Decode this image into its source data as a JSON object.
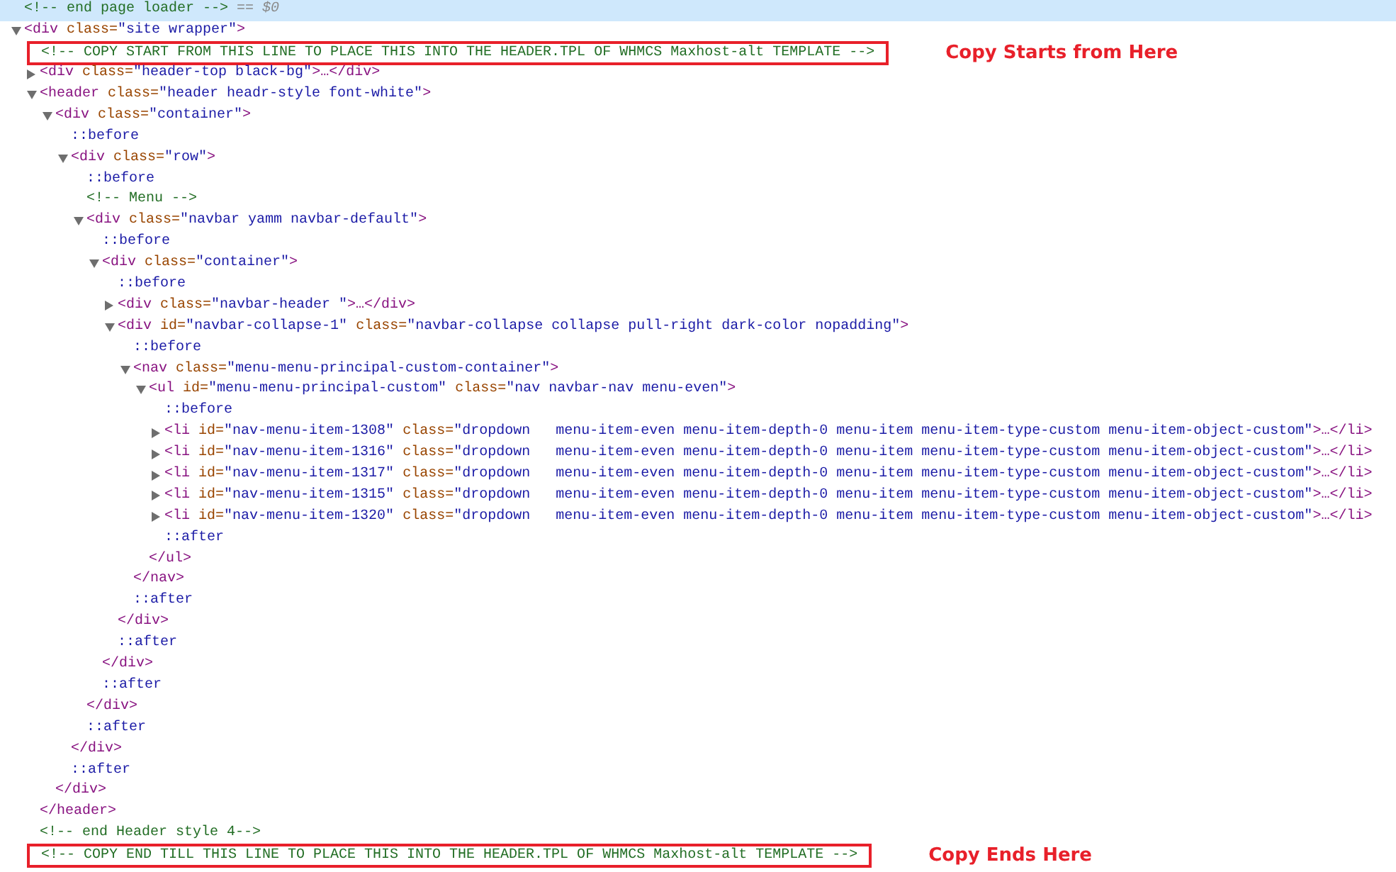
{
  "dom_tree": [
    {
      "kind": "comment",
      "selected": true,
      "open": [
        {
          "kind": "comment",
          "text": "<!-- end page loader -->"
        },
        {
          "kind": "hint",
          "text": " == $0"
        }
      ]
    },
    {
      "kind": "element",
      "selected": false,
      "expanded": true,
      "open": [
        {
          "kind": "tag",
          "text": "<div"
        },
        {
          "kind": "attr",
          "text": " class="
        },
        {
          "kind": "value",
          "text": "\"site wrapper\""
        },
        {
          "kind": "tag",
          "text": ">"
        }
      ],
      "children": [
        {
          "kind": "comment",
          "boxed": true,
          "annotation": "Copy Starts from Here",
          "open": [
            {
              "kind": "comment",
              "text": "<!-- COPY START FROM THIS LINE TO PLACE THIS INTO THE HEADER.TPL OF WHMCS Maxhost-alt TEMPLATE -->"
            }
          ]
        },
        {
          "kind": "element",
          "expanded": false,
          "open": [
            {
              "kind": "tag",
              "text": "<div"
            },
            {
              "kind": "attr",
              "text": " class="
            },
            {
              "kind": "value",
              "text": "\"header-top black-bg\""
            },
            {
              "kind": "tag",
              "text": ">…</div>"
            }
          ]
        },
        {
          "kind": "element",
          "expanded": true,
          "open": [
            {
              "kind": "tag",
              "text": "<header"
            },
            {
              "kind": "attr",
              "text": " class="
            },
            {
              "kind": "value",
              "text": "\"header headr-style font-white\""
            },
            {
              "kind": "tag",
              "text": ">"
            }
          ],
          "children": [
            {
              "kind": "element",
              "expanded": true,
              "open": [
                {
                  "kind": "tag",
                  "text": "<div"
                },
                {
                  "kind": "attr",
                  "text": " class="
                },
                {
                  "kind": "value",
                  "text": "\"container\""
                },
                {
                  "kind": "tag",
                  "text": ">"
                }
              ],
              "children": [
                {
                  "kind": "pseudo",
                  "open": [
                    {
                      "kind": "pseudo",
                      "text": "::before"
                    }
                  ]
                },
                {
                  "kind": "element",
                  "expanded": true,
                  "open": [
                    {
                      "kind": "tag",
                      "text": "<div"
                    },
                    {
                      "kind": "attr",
                      "text": " class="
                    },
                    {
                      "kind": "value",
                      "text": "\"row\""
                    },
                    {
                      "kind": "tag",
                      "text": ">"
                    }
                  ],
                  "children": [
                    {
                      "kind": "pseudo",
                      "open": [
                        {
                          "kind": "pseudo",
                          "text": "::before"
                        }
                      ]
                    },
                    {
                      "kind": "comment",
                      "open": [
                        {
                          "kind": "comment",
                          "text": "<!-- Menu -->"
                        }
                      ]
                    },
                    {
                      "kind": "element",
                      "expanded": true,
                      "open": [
                        {
                          "kind": "tag",
                          "text": "<div"
                        },
                        {
                          "kind": "attr",
                          "text": " class="
                        },
                        {
                          "kind": "value",
                          "text": "\"navbar yamm navbar-default\""
                        },
                        {
                          "kind": "tag",
                          "text": ">"
                        }
                      ],
                      "children": [
                        {
                          "kind": "pseudo",
                          "open": [
                            {
                              "kind": "pseudo",
                              "text": "::before"
                            }
                          ]
                        },
                        {
                          "kind": "element",
                          "expanded": true,
                          "open": [
                            {
                              "kind": "tag",
                              "text": "<div"
                            },
                            {
                              "kind": "attr",
                              "text": " class="
                            },
                            {
                              "kind": "value",
                              "text": "\"container\""
                            },
                            {
                              "kind": "tag",
                              "text": ">"
                            }
                          ],
                          "children": [
                            {
                              "kind": "pseudo",
                              "open": [
                                {
                                  "kind": "pseudo",
                                  "text": "::before"
                                }
                              ]
                            },
                            {
                              "kind": "element",
                              "expanded": false,
                              "open": [
                                {
                                  "kind": "tag",
                                  "text": "<div"
                                },
                                {
                                  "kind": "attr",
                                  "text": " class="
                                },
                                {
                                  "kind": "value",
                                  "text": "\"navbar-header \""
                                },
                                {
                                  "kind": "tag",
                                  "text": ">…</div>"
                                }
                              ]
                            },
                            {
                              "kind": "element",
                              "expanded": true,
                              "open": [
                                {
                                  "kind": "tag",
                                  "text": "<div"
                                },
                                {
                                  "kind": "attr",
                                  "text": " id="
                                },
                                {
                                  "kind": "value",
                                  "text": "\"navbar-collapse-1\""
                                },
                                {
                                  "kind": "attr",
                                  "text": " class="
                                },
                                {
                                  "kind": "value",
                                  "text": "\"navbar-collapse collapse pull-right dark-color nopadding\""
                                },
                                {
                                  "kind": "tag",
                                  "text": ">"
                                }
                              ],
                              "children": [
                                {
                                  "kind": "pseudo",
                                  "open": [
                                    {
                                      "kind": "pseudo",
                                      "text": "::before"
                                    }
                                  ]
                                },
                                {
                                  "kind": "element",
                                  "expanded": true,
                                  "open": [
                                    {
                                      "kind": "tag",
                                      "text": "<nav"
                                    },
                                    {
                                      "kind": "attr",
                                      "text": " class="
                                    },
                                    {
                                      "kind": "value",
                                      "text": "\"menu-menu-principal-custom-container\""
                                    },
                                    {
                                      "kind": "tag",
                                      "text": ">"
                                    }
                                  ],
                                  "children": [
                                    {
                                      "kind": "element",
                                      "expanded": true,
                                      "open": [
                                        {
                                          "kind": "tag",
                                          "text": "<ul"
                                        },
                                        {
                                          "kind": "attr",
                                          "text": " id="
                                        },
                                        {
                                          "kind": "value",
                                          "text": "\"menu-menu-principal-custom\""
                                        },
                                        {
                                          "kind": "attr",
                                          "text": " class="
                                        },
                                        {
                                          "kind": "value",
                                          "text": "\"nav navbar-nav menu-even\""
                                        },
                                        {
                                          "kind": "tag",
                                          "text": ">"
                                        }
                                      ],
                                      "children": [
                                        {
                                          "kind": "pseudo",
                                          "open": [
                                            {
                                              "kind": "pseudo",
                                              "text": "::before"
                                            }
                                          ]
                                        },
                                        {
                                          "kind": "element",
                                          "expanded": false,
                                          "open": [
                                            {
                                              "kind": "tag",
                                              "text": "<li"
                                            },
                                            {
                                              "kind": "attr",
                                              "text": " id="
                                            },
                                            {
                                              "kind": "value",
                                              "text": "\"nav-menu-item-1308\""
                                            },
                                            {
                                              "kind": "attr",
                                              "text": " class="
                                            },
                                            {
                                              "kind": "value",
                                              "text": "\"dropdown   menu-item-even menu-item-depth-0 menu-item menu-item-type-custom menu-item-object-custom\""
                                            },
                                            {
                                              "kind": "tag",
                                              "text": ">…</li>"
                                            }
                                          ]
                                        },
                                        {
                                          "kind": "element",
                                          "expanded": false,
                                          "open": [
                                            {
                                              "kind": "tag",
                                              "text": "<li"
                                            },
                                            {
                                              "kind": "attr",
                                              "text": " id="
                                            },
                                            {
                                              "kind": "value",
                                              "text": "\"nav-menu-item-1316\""
                                            },
                                            {
                                              "kind": "attr",
                                              "text": " class="
                                            },
                                            {
                                              "kind": "value",
                                              "text": "\"dropdown   menu-item-even menu-item-depth-0 menu-item menu-item-type-custom menu-item-object-custom\""
                                            },
                                            {
                                              "kind": "tag",
                                              "text": ">…</li>"
                                            }
                                          ]
                                        },
                                        {
                                          "kind": "element",
                                          "expanded": false,
                                          "open": [
                                            {
                                              "kind": "tag",
                                              "text": "<li"
                                            },
                                            {
                                              "kind": "attr",
                                              "text": " id="
                                            },
                                            {
                                              "kind": "value",
                                              "text": "\"nav-menu-item-1317\""
                                            },
                                            {
                                              "kind": "attr",
                                              "text": " class="
                                            },
                                            {
                                              "kind": "value",
                                              "text": "\"dropdown   menu-item-even menu-item-depth-0 menu-item menu-item-type-custom menu-item-object-custom\""
                                            },
                                            {
                                              "kind": "tag",
                                              "text": ">…</li>"
                                            }
                                          ]
                                        },
                                        {
                                          "kind": "element",
                                          "expanded": false,
                                          "open": [
                                            {
                                              "kind": "tag",
                                              "text": "<li"
                                            },
                                            {
                                              "kind": "attr",
                                              "text": " id="
                                            },
                                            {
                                              "kind": "value",
                                              "text": "\"nav-menu-item-1315\""
                                            },
                                            {
                                              "kind": "attr",
                                              "text": " class="
                                            },
                                            {
                                              "kind": "value",
                                              "text": "\"dropdown   menu-item-even menu-item-depth-0 menu-item menu-item-type-custom menu-item-object-custom\""
                                            },
                                            {
                                              "kind": "tag",
                                              "text": ">…</li>"
                                            }
                                          ]
                                        },
                                        {
                                          "kind": "element",
                                          "expanded": false,
                                          "open": [
                                            {
                                              "kind": "tag",
                                              "text": "<li"
                                            },
                                            {
                                              "kind": "attr",
                                              "text": " id="
                                            },
                                            {
                                              "kind": "value",
                                              "text": "\"nav-menu-item-1320\""
                                            },
                                            {
                                              "kind": "attr",
                                              "text": " class="
                                            },
                                            {
                                              "kind": "value",
                                              "text": "\"dropdown   menu-item-even menu-item-depth-0 menu-item menu-item-type-custom menu-item-object-custom\""
                                            },
                                            {
                                              "kind": "tag",
                                              "text": ">…</li>"
                                            }
                                          ]
                                        },
                                        {
                                          "kind": "pseudo",
                                          "open": [
                                            {
                                              "kind": "pseudo",
                                              "text": "::after"
                                            }
                                          ]
                                        }
                                      ],
                                      "close": [
                                        {
                                          "kind": "tag",
                                          "text": "</ul>"
                                        }
                                      ]
                                    }
                                  ],
                                  "close": [
                                    {
                                      "kind": "tag",
                                      "text": "</nav>"
                                    }
                                  ]
                                },
                                {
                                  "kind": "pseudo",
                                  "open": [
                                    {
                                      "kind": "pseudo",
                                      "text": "::after"
                                    }
                                  ]
                                }
                              ],
                              "close": [
                                {
                                  "kind": "tag",
                                  "text": "</div>"
                                }
                              ]
                            },
                            {
                              "kind": "pseudo",
                              "open": [
                                {
                                  "kind": "pseudo",
                                  "text": "::after"
                                }
                              ]
                            }
                          ],
                          "close": [
                            {
                              "kind": "tag",
                              "text": "</div>"
                            }
                          ]
                        },
                        {
                          "kind": "pseudo",
                          "open": [
                            {
                              "kind": "pseudo",
                              "text": "::after"
                            }
                          ]
                        }
                      ],
                      "close": [
                        {
                          "kind": "tag",
                          "text": "</div>"
                        }
                      ]
                    },
                    {
                      "kind": "pseudo",
                      "open": [
                        {
                          "kind": "pseudo",
                          "text": "::after"
                        }
                      ]
                    }
                  ],
                  "close": [
                    {
                      "kind": "tag",
                      "text": "</div>"
                    }
                  ]
                },
                {
                  "kind": "pseudo",
                  "open": [
                    {
                      "kind": "pseudo",
                      "text": "::after"
                    }
                  ]
                }
              ],
              "close": [
                {
                  "kind": "tag",
                  "text": "</div>"
                }
              ]
            }
          ],
          "close": [
            {
              "kind": "tag",
              "text": "</header>"
            }
          ]
        },
        {
          "kind": "comment",
          "open": [
            {
              "kind": "comment",
              "text": "<!-- end Header style 4-->"
            }
          ]
        },
        {
          "kind": "comment",
          "boxed": true,
          "annotation": "Copy Ends Here",
          "open": [
            {
              "kind": "comment",
              "text": "<!-- COPY END TILL THIS LINE TO PLACE THIS INTO THE HEADER.TPL OF WHMCS Maxhost-alt TEMPLATE -->"
            }
          ]
        }
      ]
    }
  ]
}
